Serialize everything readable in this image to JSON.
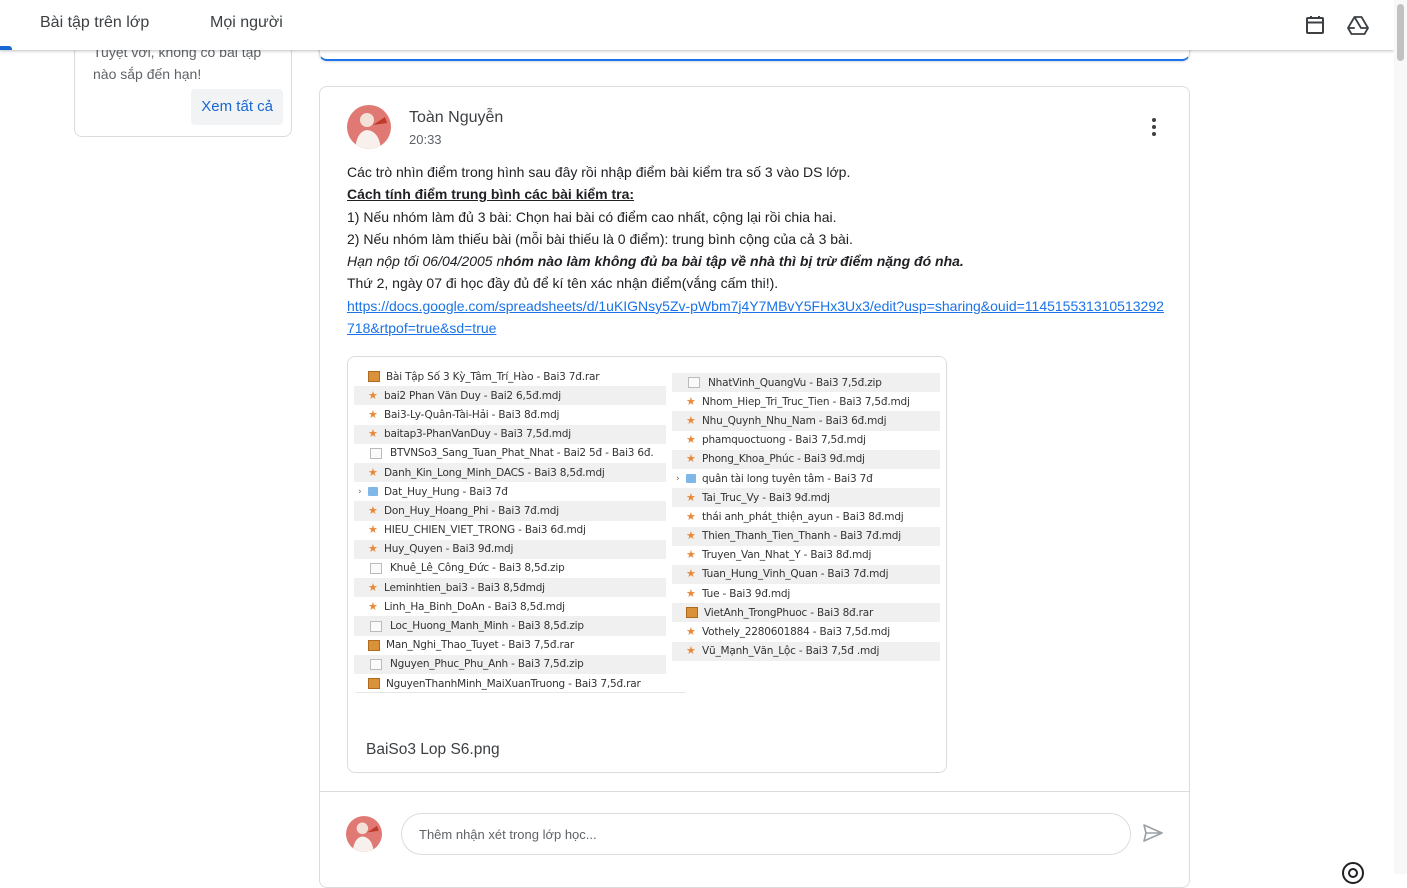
{
  "nav": {
    "tab_classwork": "Bài tập trên lớp",
    "tab_people": "Mọi người",
    "calendar_icon": "calendar-icon",
    "drive_icon": "google-drive-icon"
  },
  "upcoming": {
    "text": "Tuyệt vời, không có bài tập nào sắp đến hạn!",
    "view_all": "Xem tất cả"
  },
  "post": {
    "author": "Toàn Nguyễn",
    "time": "20:33",
    "line1": "Các trò nhìn điểm trong hình sau đây rồi nhập điểm bài kiểm tra số 3 vào DS lớp.",
    "line2": "Cách tính điểm trung bình các bài kiểm tra:",
    "line3": "1) Nếu nhóm làm đủ 3 bài: Chọn hai bài có điểm cao nhất, cộng lại rồi chia hai.",
    "line4": "2) Nếu nhóm làm thiếu bài (mỗi bài thiếu là 0 điểm): trung bình cộng của cả 3 bài.",
    "line5_italic": "Hạn nộp tối 06/04/2005  n",
    "line5_bold": "hóm nào làm không đủ ba bài tập về nhà thì bị trừ điểm nặng đó nha.",
    "line6": "Thứ 2, ngày 07 đi học đầy đủ để kí tên xác nhận điểm(vắng cấm thi!).",
    "link": "https://docs.google.com/spreadsheets/d/1uKIGNsy5Zv-pWbm7j4Y7MBvY5FHx3Ux3/edit?usp=sharing&ouid=114515531310513292718&rtpof=true&sd=true",
    "attachment_name": "BaiSo3 Lop S6.png"
  },
  "files_left": [
    {
      "icon": "rar",
      "name": "Bài Tập Số 3 Kỳ_Tâm_Trí_Hào - Bai3 7đ.rar"
    },
    {
      "icon": "star",
      "name": "bai2 Phan Văn Duy - Bai2 6,5đ.mdj"
    },
    {
      "icon": "star",
      "name": "Bai3-Ly-Quân-Tài-Hải - Bai3 8đ.mdj"
    },
    {
      "icon": "star",
      "name": "baitap3-PhanVanDuy - Bai3 7,5đ.mdj"
    },
    {
      "icon": "zip",
      "name": "BTVNSo3_Sang_Tuan_Phat_Nhat - Bai2 5đ - Bai3 6đ."
    },
    {
      "icon": "star",
      "name": "Danh_Kin_Long_Minh_DACS - Bai3 8,5đ.mdj"
    },
    {
      "icon": "folder",
      "name": "Dat_Huy_Hung - Bai3 7đ"
    },
    {
      "icon": "star",
      "name": "Don_Huy_Hoang_Phi - Bai3 7đ.mdj"
    },
    {
      "icon": "star",
      "name": "HIEU_CHIEN_VIET_TRONG - Bai3 6đ.mdj"
    },
    {
      "icon": "star",
      "name": "Huy_Quyen - Bai3 9đ.mdj"
    },
    {
      "icon": "zip",
      "name": "Khuê_Lê_Công_Đức - Bai3 8,5đ.zip"
    },
    {
      "icon": "star",
      "name": "Leminhtien_bai3 - Bai3 8,5đmdj"
    },
    {
      "icon": "star",
      "name": "Linh_Ha_Binh_DoAn - Bai3 8,5đ.mdj"
    },
    {
      "icon": "zip",
      "name": "Loc_Huong_Manh_Minh - Bai3 8,5đ.zip"
    },
    {
      "icon": "rar",
      "name": "Man_Nghi_Thao_Tuyet - Bai3 7,5đ.rar"
    },
    {
      "icon": "zip",
      "name": "Nguyen_Phuc_Phu_Anh - Bai3 7,5đ.zip"
    },
    {
      "icon": "rar",
      "name": "NguyenThanhMinh_MaiXuanTruong - Bai3 7,5đ.rar"
    }
  ],
  "files_right": [
    {
      "icon": "zip",
      "name": "NhatVinh_QuangVu - Bai3 7,5đ.zip"
    },
    {
      "icon": "star",
      "name": "Nhom_Hiep_Tri_Truc_Tien - Bai3 7,5đ.mdj"
    },
    {
      "icon": "star",
      "name": "Nhu_Quynh_Nhu_Nam - Bai3 6đ.mdj"
    },
    {
      "icon": "star",
      "name": "phamquoctuong - Bai3 7,5đ.mdj"
    },
    {
      "icon": "star",
      "name": "Phong_Khoa_Phúc - Bai3 9đ.mdj"
    },
    {
      "icon": "folder",
      "name": "quân tài long tuyên tâm - Bai3 7đ"
    },
    {
      "icon": "star",
      "name": "Tai_Truc_Vy - Bai3 9đ.mdj"
    },
    {
      "icon": "star",
      "name": "thái anh_phát_thiện_ayun - Bai3 8đ.mdj"
    },
    {
      "icon": "star",
      "name": "Thien_Thanh_Tien_Thanh - Bai3 7đ.mdj"
    },
    {
      "icon": "star",
      "name": "Truyen_Van_Nhat_Y - Bai3 8đ.mdj"
    },
    {
      "icon": "star",
      "name": "Tuan_Hung_Vinh_Quan - Bai3 7đ.mdj"
    },
    {
      "icon": "star",
      "name": "Tue - Bai3 9đ.mdj"
    },
    {
      "icon": "rar",
      "name": "VietAnh_TrongPhuoc - Bai3 8đ.rar"
    },
    {
      "icon": "star",
      "name": "Vothely_2280601884 - Bai3 7,5đ.mdj"
    },
    {
      "icon": "star",
      "name": "Vũ_Mạnh_Văn_Lộc - Bai3 7,5đ .mdj"
    }
  ],
  "comment": {
    "placeholder": "Thêm nhận xét trong lớp học..."
  },
  "colors": {
    "accent": "#1967d2",
    "link": "#1a73e8",
    "border": "#dadce0"
  }
}
